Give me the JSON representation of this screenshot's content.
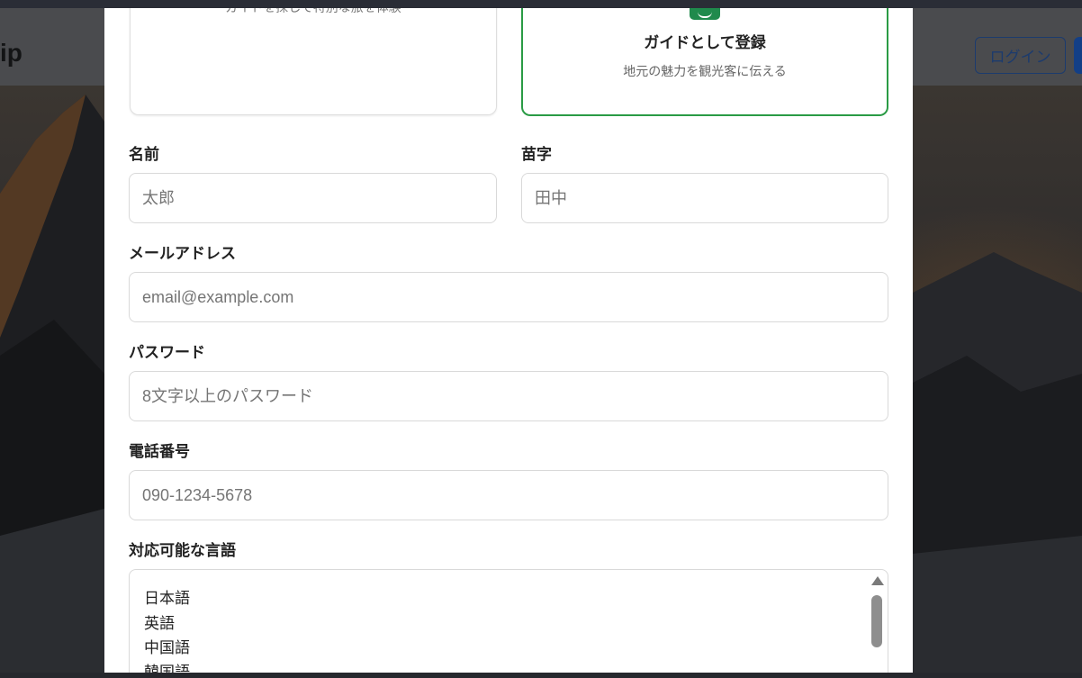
{
  "background": {
    "brand": "ip",
    "login_label": "ログイン"
  },
  "modal": {
    "traveler_card": {
      "description": "ガイドを探して特別な旅を体験"
    },
    "guide_card": {
      "title": "ガイドとして登録",
      "description": "地元の魅力を観光客に伝える",
      "accent_color": "#2a9b45",
      "icon": "guide-badge-icon"
    },
    "form": {
      "first_name": {
        "label": "名前",
        "placeholder": "太郎"
      },
      "last_name": {
        "label": "苗字",
        "placeholder": "田中"
      },
      "email": {
        "label": "メールアドレス",
        "placeholder": "email@example.com"
      },
      "password": {
        "label": "パスワード",
        "placeholder": "8文字以上のパスワード"
      },
      "phone": {
        "label": "電話番号",
        "placeholder": "090-1234-5678"
      },
      "languages": {
        "label": "対応可能な言語",
        "options": [
          "日本語",
          "英語",
          "中国語",
          "韓国語"
        ]
      }
    }
  }
}
